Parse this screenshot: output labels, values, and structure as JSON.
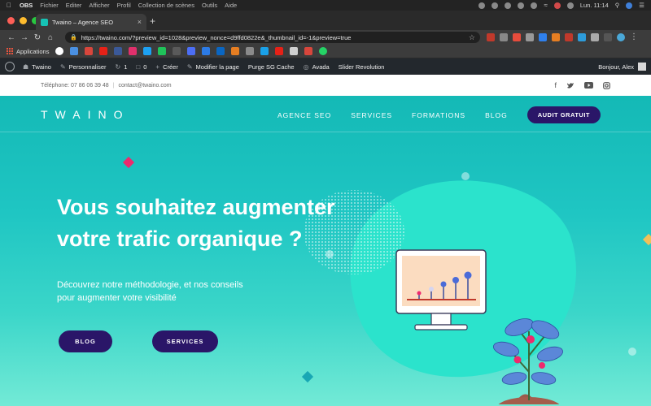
{
  "menubar": {
    "app": "OBS",
    "items": [
      "Fichier",
      "Editer",
      "Afficher",
      "Profil",
      "Collection de scènes",
      "Outils",
      "Aide"
    ],
    "clock": "Lun. 11:14"
  },
  "browser": {
    "tab_title": "Twaino – Agence SEO",
    "url": "https://twaino.com/?preview_id=1028&preview_nonce=d9ffd0822e&_thumbnail_id=-1&preview=true"
  },
  "bookmarks": {
    "apps_label": "Applications"
  },
  "wpbar": {
    "site_name": "Twaino",
    "customize": "Personnaliser",
    "updates_count": "1",
    "comments_count": "0",
    "create": "Créer",
    "edit_page": "Modifier la page",
    "purge": "Purge SG Cache",
    "avada": "Avada",
    "slider": "Slider Revolution",
    "greeting": "Bonjour, Alex"
  },
  "site": {
    "phone": "Téléphone: 07 86 06 39 48",
    "email": "contact@twaino.com",
    "logo": "TWAINO",
    "nav": {
      "agence": "AGENCE SEO",
      "services": "SERVICES",
      "formations": "FORMATIONS",
      "blog": "BLOG",
      "cta": "AUDIT GRATUIT"
    },
    "hero": {
      "title_line1": "Vous souhaitez augmenter",
      "title_line2": "votre trafic organique ?",
      "sub_line1": "Découvrez notre méthodologie, et nos conseils",
      "sub_line2": "pour augmenter votre visibilité",
      "btn_blog": "BLOG",
      "btn_services": "SERVICES"
    }
  },
  "colors": {
    "brand_teal": "#16c3b5",
    "brand_dark": "#2a1668",
    "accent_pink": "#ee2a6e"
  }
}
